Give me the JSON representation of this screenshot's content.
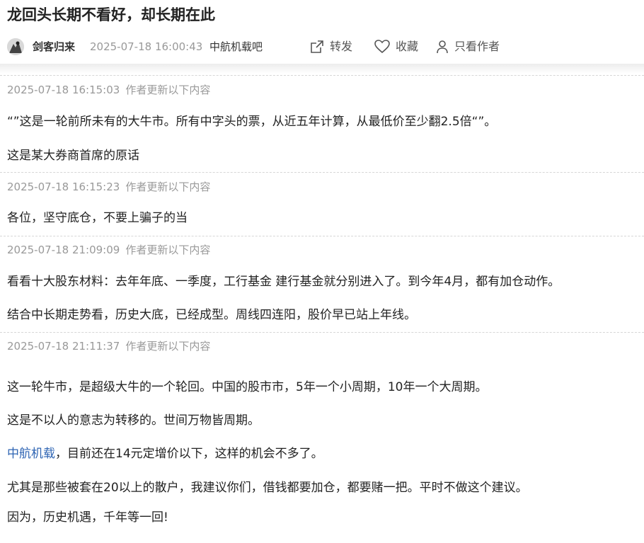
{
  "post": {
    "title": "龙回头长期不看好，却长期在此",
    "author": "剑客归来",
    "time": "2025-07-18 16:00:43",
    "bar": "中航机载吧"
  },
  "actions": {
    "share": "转发",
    "favorite": "收藏",
    "author_only": "只看作者"
  },
  "updates": [
    {
      "time": "2025-07-18 16:15:03",
      "label": "作者更新以下内容",
      "paragraphs": [
        "“”这是一轮前所未有的大牛市。所有中字头的票，从近五年计算，从最低价至少翻2.5倍“”。",
        "这是某大券商首席的原话"
      ]
    },
    {
      "time": "2025-07-18 16:15:23",
      "label": "作者更新以下内容",
      "paragraphs": [
        "各位，坚守底仓，不要上骗子的当"
      ]
    },
    {
      "time": "2025-07-18 21:09:09",
      "label": "作者更新以下内容",
      "paragraphs": [
        "看看十大股东材料：去年年底、一季度，工行基金 建行基金就分别进入了。到今年4月，都有加仓动作。",
        "结合中长期走势看，历史大底，已经成型。周线四连阳，股价早已站上年线。"
      ]
    },
    {
      "time": "2025-07-18 21:11:37",
      "label": "作者更新以下内容",
      "paragraphs": [
        "这一轮牛市，是超级大牛的一个轮回。中国的股市市，5年一个小周期，10年一个大周期。",
        "这是不以人的意志为转移的。世间万物皆周期。",
        "",
        "尤其是那些被套在20以上的散户，我建议你们，借钱都要加仓，都要赌一把。平时不做这个建议。",
        "因为，历史机遇，千年等一回!"
      ],
      "link_paragraph": {
        "link": "中航机载",
        "rest": "，目前还在14元定增价以下，这样的机会不多了。"
      }
    }
  ],
  "colors": {
    "link": "#2e64b3",
    "muted": "#999999",
    "text": "#222222"
  }
}
